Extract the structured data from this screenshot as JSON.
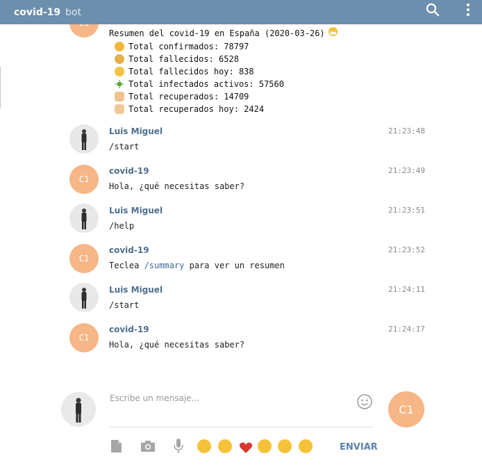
{
  "header": {
    "title": "covid-19",
    "subtitle": "bot",
    "search_icon": "search-icon",
    "more_icon": "more-vertical-icon"
  },
  "summary": {
    "avatar_initials": "C1",
    "heading": "Resumen del covid-19 en España (2020-03-26)",
    "lines": [
      "Total confirmados: 78797",
      "Total fallecidos: 6528",
      "Total fallecidos hoy: 838",
      "Total infectados activos: 57560",
      "Total recuperados: 14709",
      "Total recuperados hoy: 2424"
    ]
  },
  "messages": [
    {
      "name": "Luis Miguel",
      "time": "21:23:48",
      "text": "/start"
    },
    {
      "name": "covid-19",
      "initials": "C1",
      "time": "21:23:49",
      "text": "Hola, ¿qué necesitas saber?"
    },
    {
      "name": "Luis Miguel",
      "time": "21:23:51",
      "text": "/help"
    },
    {
      "name": "covid-19",
      "initials": "C1",
      "time": "21:23:52",
      "text_pre": "Teclea ",
      "text_cmd": "/summary",
      "text_post": " para ver un resumen"
    },
    {
      "name": "Luis Miguel",
      "time": "21:24:11",
      "text": "/start"
    },
    {
      "name": "covid-19",
      "initials": "C1",
      "time": "21:24:17",
      "text": "Hola, ¿qué necesitas saber?"
    }
  ],
  "composer": {
    "placeholder": "Escribe un mensaje...",
    "send_avatar_initials": "C1",
    "send_label": "ENVIAR"
  },
  "colors": {
    "header": "#6c8fad",
    "bot_avatar": "#f6b686",
    "name": "#4e6e8c",
    "send": "#5a84b0"
  }
}
